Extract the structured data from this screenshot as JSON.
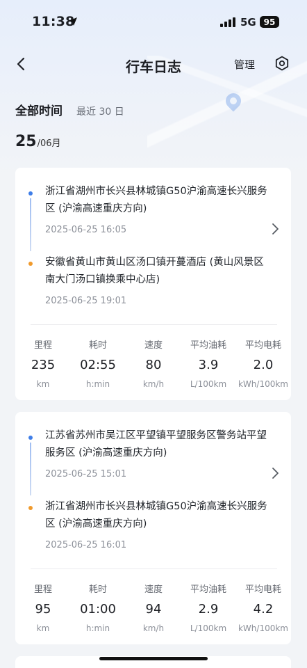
{
  "status_bar": {
    "time": "11:38",
    "network": "5G",
    "battery": "95"
  },
  "nav": {
    "title": "行车日志",
    "manage": "管理"
  },
  "filters": {
    "all_time": "全部时间",
    "recent": "最近 30 日"
  },
  "date_header": {
    "day": "25",
    "month": "/06月"
  },
  "trips": [
    {
      "start": {
        "address": "浙江省湖州市长兴县林城镇G50沪渝高速长兴服务区 (沪渝高速重庆方向)",
        "time": "2025-06-25 16:05"
      },
      "end": {
        "address": "安徽省黄山市黄山区汤口镇开蔓酒店 (黄山风景区南大门汤口镇换乘中心店)",
        "time": "2025-06-25 19:01"
      },
      "stats": [
        {
          "label": "里程",
          "value": "235",
          "unit": "km"
        },
        {
          "label": "耗时",
          "value": "02:55",
          "unit": "h:min"
        },
        {
          "label": "速度",
          "value": "80",
          "unit": "km/h"
        },
        {
          "label": "平均油耗",
          "value": "3.9",
          "unit": "L/100km"
        },
        {
          "label": "平均电耗",
          "value": "2.0",
          "unit": "kWh/100km"
        }
      ]
    },
    {
      "start": {
        "address": "江苏省苏州市吴江区平望镇平望服务区警务站平望服务区 (沪渝高速重庆方向)",
        "time": "2025-06-25 15:01"
      },
      "end": {
        "address": "浙江省湖州市长兴县林城镇G50沪渝高速长兴服务区 (沪渝高速重庆方向)",
        "time": "2025-06-25 16:01"
      },
      "stats": [
        {
          "label": "里程",
          "value": "95",
          "unit": "km"
        },
        {
          "label": "耗时",
          "value": "01:00",
          "unit": "h:min"
        },
        {
          "label": "速度",
          "value": "94",
          "unit": "km/h"
        },
        {
          "label": "平均油耗",
          "value": "2.9",
          "unit": "L/100km"
        },
        {
          "label": "平均电耗",
          "value": "4.2",
          "unit": "kWh/100km"
        }
      ]
    }
  ],
  "icons": {
    "location": "location-arrow-icon",
    "back": "back-arrow-icon",
    "settings": "hexagon-settings-icon",
    "chevron": "chevron-right-icon"
  },
  "colors": {
    "start_dot": "#3f7ee8",
    "end_dot": "#f09a2c"
  }
}
